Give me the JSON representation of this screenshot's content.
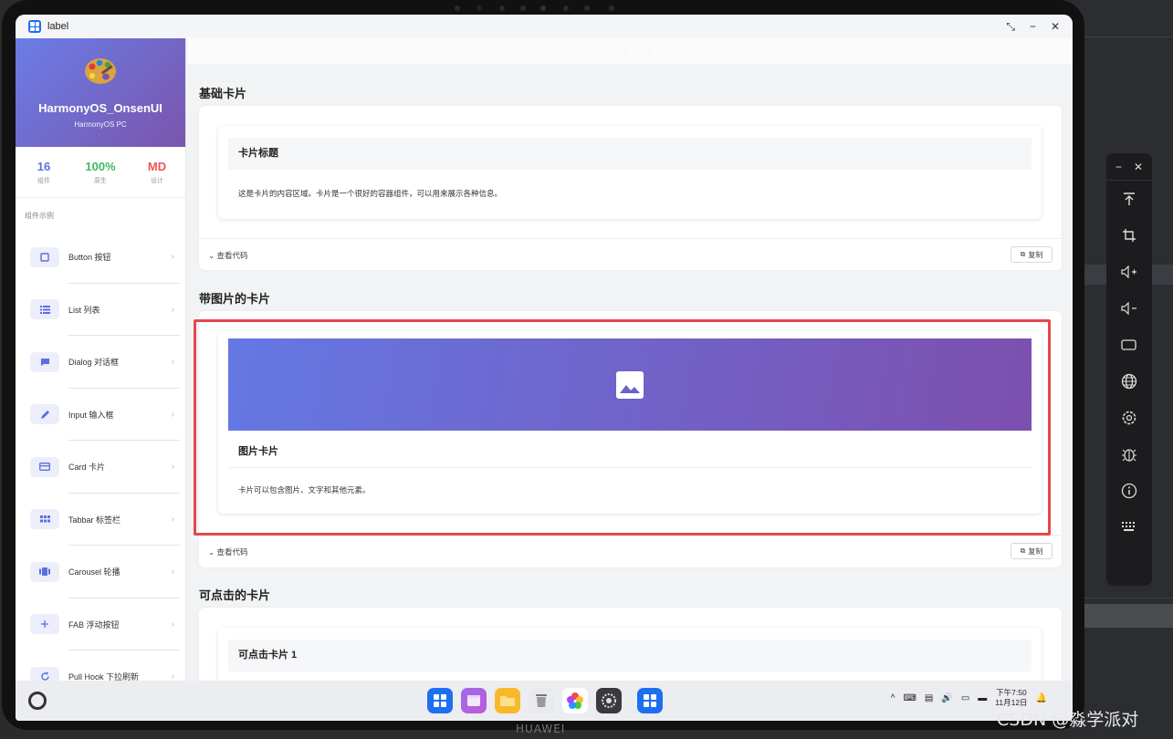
{
  "window": {
    "title": "label"
  },
  "sidebar": {
    "app_name": "HarmonyOS_OnsenUI",
    "app_sub": "HarmonyOS PC",
    "stats": [
      {
        "value": "16",
        "label": "组件",
        "color": "#5b6ee1"
      },
      {
        "value": "100%",
        "label": "原生",
        "color": "#3fb85f"
      },
      {
        "value": "MD",
        "label": "设计",
        "color": "#ef5350"
      }
    ],
    "section_label": "组件示例",
    "items": [
      {
        "label": "Button 按钮",
        "icon": "square-icon"
      },
      {
        "label": "List 列表",
        "icon": "list-icon"
      },
      {
        "label": "Dialog 对话框",
        "icon": "chat-icon"
      },
      {
        "label": "Input 输入框",
        "icon": "pencil-icon"
      },
      {
        "label": "Card 卡片",
        "icon": "card-icon"
      },
      {
        "label": "Tabbar 标签栏",
        "icon": "grid-icon"
      },
      {
        "label": "Carousel 轮播",
        "icon": "carousel-icon"
      },
      {
        "label": "FAB 浮动按钮",
        "icon": "plus-icon"
      },
      {
        "label": "Pull Hook 下拉刷新",
        "icon": "refresh-icon"
      }
    ]
  },
  "content": {
    "topbar_title": "Card 卡片",
    "sections": [
      {
        "title": "基础卡片",
        "card_title": "卡片标题",
        "card_text": "这是卡片的内容区域。卡片是一个很好的容器组件，可以用来展示各种信息。"
      },
      {
        "title": "带图片的卡片",
        "card_title": "图片卡片",
        "card_text": "卡片可以包含图片、文字和其他元素。"
      },
      {
        "title": "可点击的卡片",
        "card_title": "可点击卡片 1"
      }
    ],
    "view_code_label": "查看代码",
    "copy_label": "复制"
  },
  "taskbar": {
    "clock_time": "下午7:50",
    "clock_date": "11月12日"
  },
  "device_brand": "HUAWEI",
  "watermark": "CSDN @淼学派对"
}
